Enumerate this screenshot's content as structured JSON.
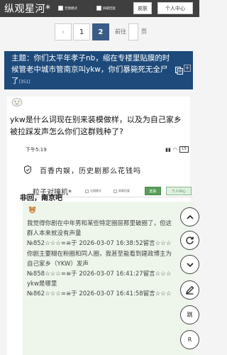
{
  "header": {
    "site_title": "纵观星河*",
    "toggle_1": "无图模式",
    "toggle_2": "屏蔽回复",
    "skin_button": "皮肤",
    "user_center_button": "个人中心"
  },
  "pager": {
    "prev": "‹",
    "pages": [
      "1",
      "2"
    ],
    "current": "2",
    "goto_prefix": "前往",
    "goto_suffix": "页"
  },
  "topic": {
    "text": "主题：你们太平年孝子nb，缩在专楼里贴膜的时候管老中城市管南京叫ykw，你们暴毙死无全尸了",
    "reply_count": "[351]",
    "plus": "+"
  },
  "post": {
    "question": "ykw是什么词现在别来装模做样，以及为自己家乡被拉踩发声怎么你们这群贱种了?"
  },
  "inner_screenshot": {
    "status_time": "下午5:19",
    "battery": "15",
    "banner": "百香内娱，历史剧那么花钱吗",
    "site_title": "粒子对撞机*",
    "toggle_1": "无图模式",
    "toggle_2": "屏蔽回复",
    "skin_button": "皮肤",
    "user_center_button": "个人中心",
    "comments": [
      "我觉得你剧在中年男和某些特定圈层那里破圈了，但这群人本来就没有声量",
      "№852☆☆☆=≡于 2026-03-07 16:38:52留言☆☆☆",
      "你剧主要糊在粉圈和同人圈，我甚至能看到建政博主为自己家乡（YKW）发声",
      "№858☆☆☆=≡于 2026-03-07 16:41:27留言☆☆☆",
      "ykw是哪里",
      "№862☆☆☆=≡于 2026-03-07 16:41:58留言☆☆☆"
    ],
    "final_reply": "非回，南京吧"
  },
  "fabs": {
    "jump_label": "跳",
    "r_label": "R"
  }
}
